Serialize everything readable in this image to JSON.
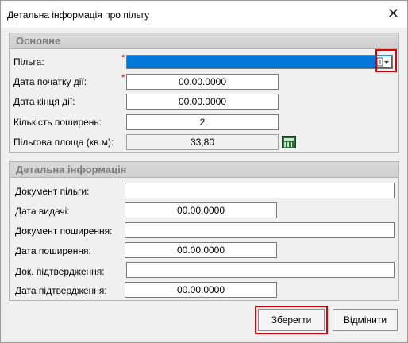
{
  "window": {
    "title": "Детальна інформація про пільгу"
  },
  "main": {
    "title": "Основне",
    "pilga_label": "Пільга:",
    "date_start_label": "Дата початку дії:",
    "date_start_value": "00.00.0000",
    "date_end_label": "Дата кінця дії:",
    "date_end_value": "00.00.0000",
    "count_label": "Кількість поширень:",
    "count_value": "2",
    "area_label": "Пільгова площа (кв.м):",
    "area_value": "33,80"
  },
  "details": {
    "title": "Детальна інформація",
    "doc_pilga_label": "Документ пільги:",
    "doc_pilga_value": "",
    "issue_date_label": "Дата видачі:",
    "issue_date_value": "00.00.0000",
    "doc_spread_label": "Документ поширення:",
    "doc_spread_value": "",
    "spread_date_label": "Дата поширення:",
    "spread_date_value": "00.00.0000",
    "doc_confirm_label": "Док. підтвердження:",
    "doc_confirm_value": "",
    "confirm_date_label": "Дата підтвердження:",
    "confirm_date_value": "00.00.0000"
  },
  "buttons": {
    "save": "Зберегти",
    "cancel": "Відмінити"
  },
  "icons": {
    "close": "close-icon",
    "dropdown": "dropdown-list-icon",
    "calculator": "calculator-icon"
  },
  "colors": {
    "selection": "#0078d7",
    "required": "#d00000",
    "highlight": "#e00000"
  }
}
